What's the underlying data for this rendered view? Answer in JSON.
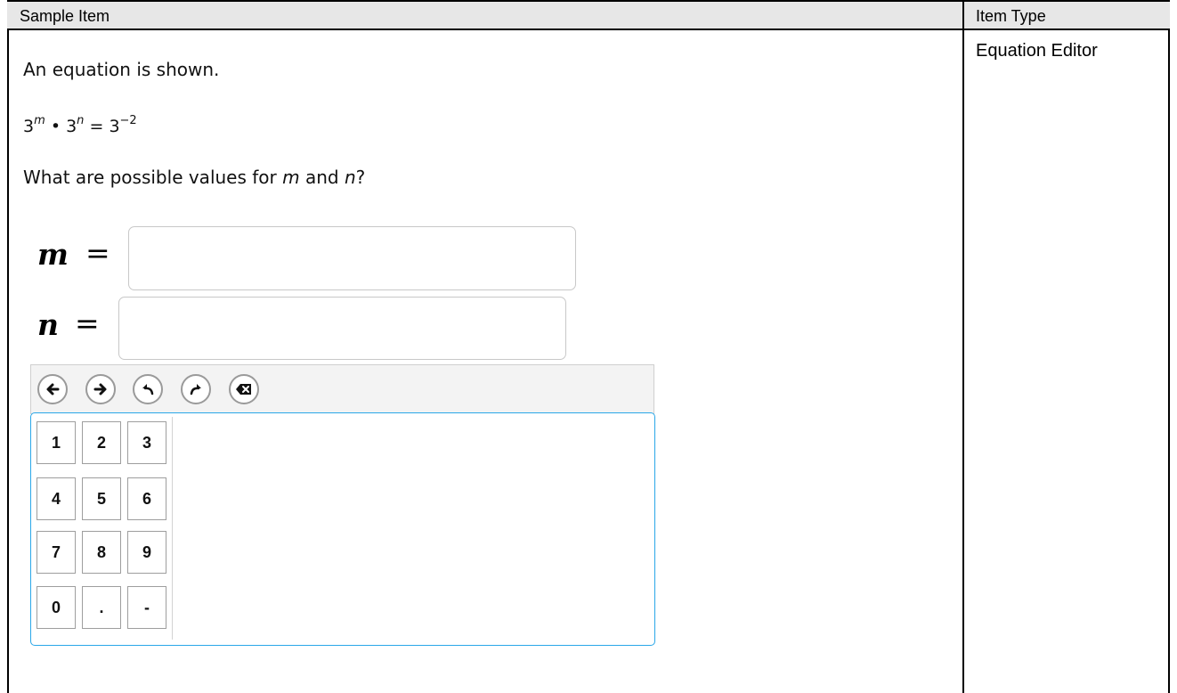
{
  "table": {
    "col_sample": "Sample Item",
    "col_type": "Item Type",
    "item_type": "Equation Editor"
  },
  "question": {
    "intro": "An equation is shown.",
    "equation": {
      "base1": "3",
      "exp1": "m",
      "op": "•",
      "base2": "3",
      "exp2": "n",
      "equals": "=",
      "base3": "3",
      "exp3": "−2"
    },
    "prompt_start": "What are possible values for ",
    "prompt_var1": "m",
    "prompt_and": " and ",
    "prompt_var2": "n",
    "prompt_end": "?"
  },
  "answers": {
    "m_label": "m",
    "n_label": "n",
    "equals": "=",
    "m_value": "",
    "n_value": ""
  },
  "toolbar": {
    "buttons": [
      "arrow-left-icon",
      "arrow-right-icon",
      "undo-icon",
      "redo-icon",
      "backspace-icon"
    ]
  },
  "keypad": {
    "keys": [
      "1",
      "2",
      "3",
      "4",
      "5",
      "6",
      "7",
      "8",
      "9",
      "0",
      ".",
      "-"
    ]
  }
}
